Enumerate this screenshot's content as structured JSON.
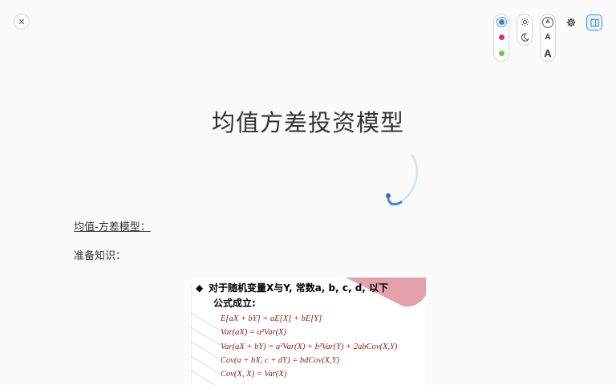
{
  "toolbar": {
    "close_icon_glyph": "✕",
    "theme_colors": [
      "#2f7fe0",
      "#d6307e",
      "#5ad14a"
    ],
    "selected_color_index": 0,
    "mode_icons": [
      "sun-icon",
      "moon-icon"
    ],
    "font_size_labels": [
      "A",
      "A",
      "A"
    ],
    "settings_icon": "gear-icon",
    "panel_icon": "panel-icon"
  },
  "document": {
    "title": "均值方差投资模型",
    "section_heading": "均值-方差模型：",
    "prep_label": "准备知识："
  },
  "slide": {
    "bullet": "◆",
    "intro_line1": "对于随机变量X与Y, 常数a, b, c, d, 以下",
    "intro_line2": "公式成立:",
    "formulas": [
      "E[aX + bY] = aE[X] + bE[Y]",
      "Var(aX) = a²Var(X)",
      "Var(aX + bY) = a²Var(X) + b²Var(Y) + 2abCov(X,Y)",
      "Cov(a + bX, c + dY) = bdCov(X,Y)",
      "Cov(X, X) = Var(X)"
    ],
    "accent_color": "#e4a0ad",
    "formula_color": "#8b1a1a"
  }
}
